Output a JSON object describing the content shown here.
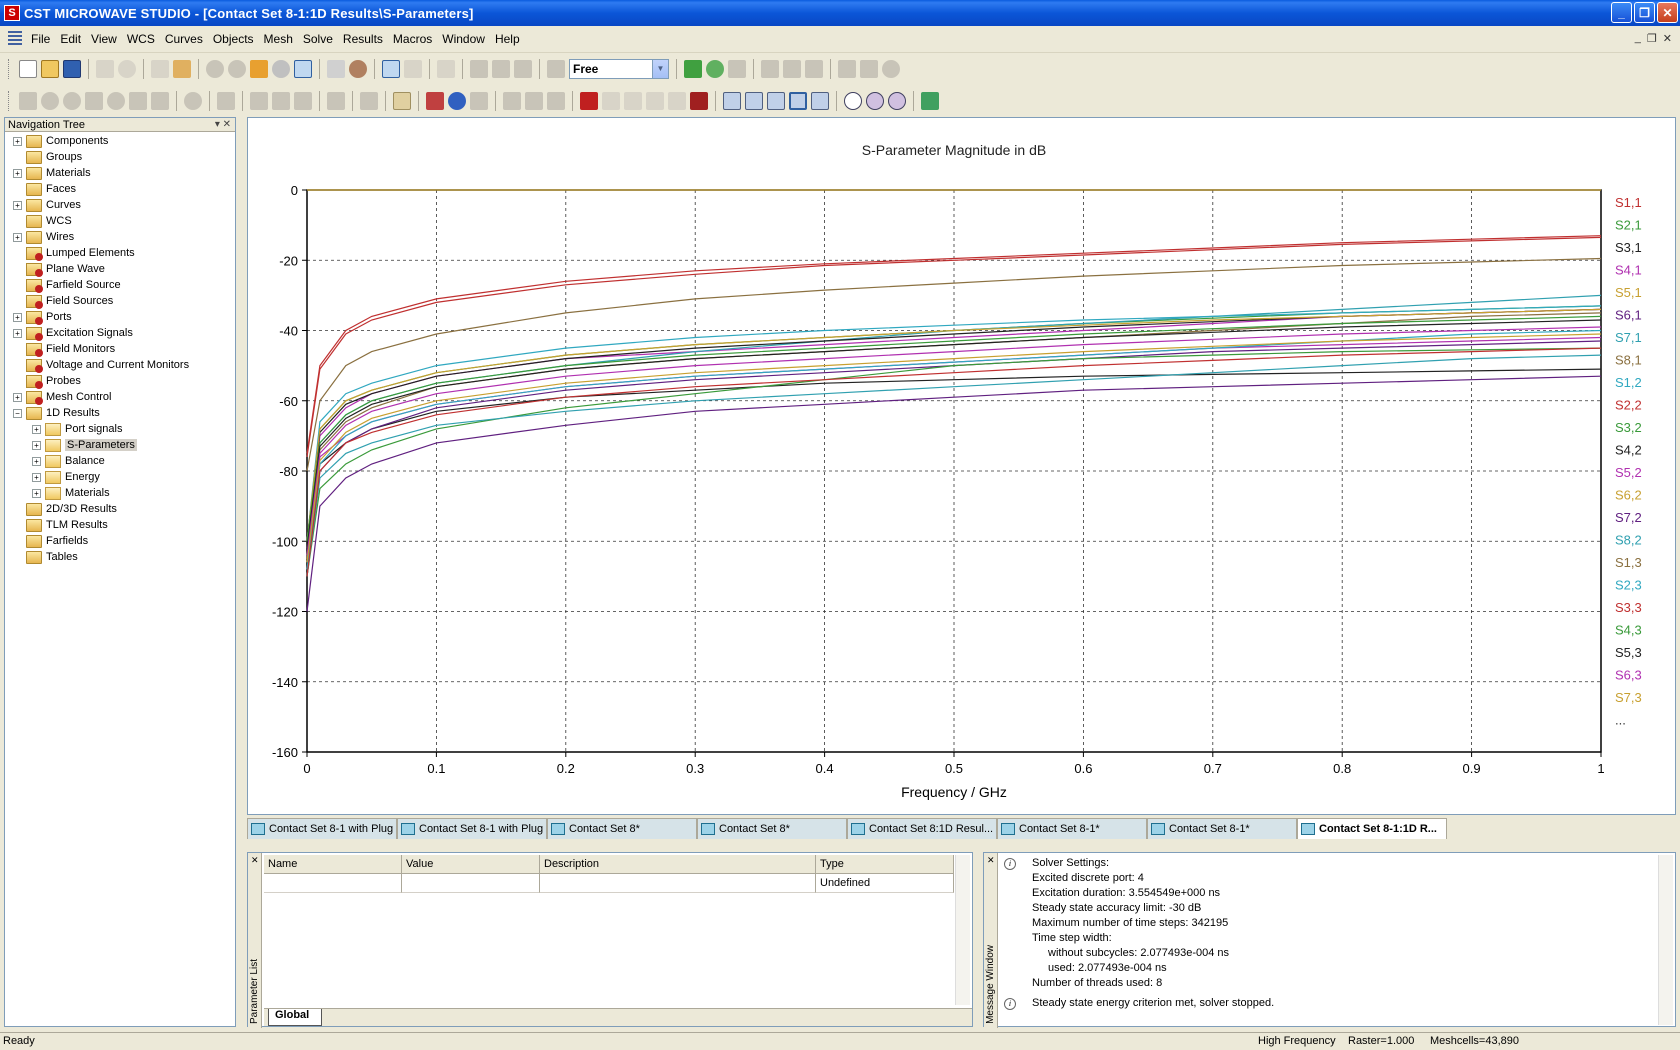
{
  "window": {
    "title": "CST MICROWAVE STUDIO - [Contact Set 8-1:1D Results\\S-Parameters]",
    "app_icon": "S",
    "buttons": {
      "minimize": "_",
      "restore": "❐",
      "close": "✕"
    }
  },
  "menu": {
    "items": [
      "File",
      "Edit",
      "View",
      "WCS",
      "Curves",
      "Objects",
      "Mesh",
      "Solve",
      "Results",
      "Macros",
      "Window",
      "Help"
    ],
    "mdi": {
      "minimize": "_",
      "restore": "❐",
      "close": "✕"
    }
  },
  "toolbar": {
    "mode_combo": "Free"
  },
  "nav": {
    "header": "Navigation Tree",
    "items": [
      {
        "label": "Components",
        "icon": "folder-icon",
        "expand": "+",
        "indent": 0,
        "style": "gold"
      },
      {
        "label": "Groups",
        "icon": "folder-icon",
        "expand": "",
        "indent": 0,
        "style": "gold"
      },
      {
        "label": "Materials",
        "icon": "folder-icon",
        "expand": "+",
        "indent": 0,
        "style": "gold"
      },
      {
        "label": "Faces",
        "icon": "folder-icon",
        "expand": "",
        "indent": 0,
        "style": "gold"
      },
      {
        "label": "Curves",
        "icon": "folder-icon",
        "expand": "+",
        "indent": 0,
        "style": "gold"
      },
      {
        "label": "WCS",
        "icon": "folder-icon",
        "expand": "",
        "indent": 0,
        "style": "gold"
      },
      {
        "label": "Wires",
        "icon": "folder-icon",
        "expand": "+",
        "indent": 0,
        "style": "gold"
      },
      {
        "label": "Lumped Elements",
        "icon": "folder-red-icon",
        "expand": "",
        "indent": 0,
        "style": "red"
      },
      {
        "label": "Plane Wave",
        "icon": "folder-red-icon",
        "expand": "",
        "indent": 0,
        "style": "red"
      },
      {
        "label": "Farfield Source",
        "icon": "folder-red-icon",
        "expand": "",
        "indent": 0,
        "style": "red"
      },
      {
        "label": "Field Sources",
        "icon": "folder-red-icon",
        "expand": "",
        "indent": 0,
        "style": "red"
      },
      {
        "label": "Ports",
        "icon": "folder-red-icon",
        "expand": "+",
        "indent": 0,
        "style": "red"
      },
      {
        "label": "Excitation Signals",
        "icon": "folder-red-icon",
        "expand": "+",
        "indent": 0,
        "style": "red"
      },
      {
        "label": "Field Monitors",
        "icon": "folder-red-icon",
        "expand": "",
        "indent": 0,
        "style": "red"
      },
      {
        "label": "Voltage and Current Monitors",
        "icon": "folder-red-icon",
        "expand": "",
        "indent": 0,
        "style": "red"
      },
      {
        "label": "Probes",
        "icon": "folder-red-icon",
        "expand": "",
        "indent": 0,
        "style": "red"
      },
      {
        "label": "Mesh Control",
        "icon": "folder-red-icon",
        "expand": "+",
        "indent": 0,
        "style": "red"
      },
      {
        "label": "1D Results",
        "icon": "folder-open-icon",
        "expand": "−",
        "indent": 0,
        "style": "gold"
      },
      {
        "label": "Port signals",
        "icon": "folder-icon",
        "expand": "+",
        "indent": 1,
        "style": "plain"
      },
      {
        "label": "S-Parameters",
        "icon": "folder-icon",
        "expand": "+",
        "indent": 1,
        "style": "plain",
        "selected": true
      },
      {
        "label": "Balance",
        "icon": "folder-icon",
        "expand": "+",
        "indent": 1,
        "style": "plain"
      },
      {
        "label": "Energy",
        "icon": "folder-icon",
        "expand": "+",
        "indent": 1,
        "style": "plain"
      },
      {
        "label": "Materials",
        "icon": "folder-icon",
        "expand": "+",
        "indent": 1,
        "style": "plain"
      },
      {
        "label": "2D/3D Results",
        "icon": "folder-icon",
        "expand": "",
        "indent": 0,
        "style": "gold"
      },
      {
        "label": "TLM Results",
        "icon": "folder-icon",
        "expand": "",
        "indent": 0,
        "style": "gold"
      },
      {
        "label": "Farfields",
        "icon": "folder-icon",
        "expand": "",
        "indent": 0,
        "style": "gold"
      },
      {
        "label": "Tables",
        "icon": "folder-icon",
        "expand": "",
        "indent": 0,
        "style": "gold"
      }
    ]
  },
  "chart_data": {
    "type": "line",
    "title": "S-Parameter Magnitude in dB",
    "xlabel": "Frequency / GHz",
    "ylabel": "",
    "xlim": [
      0,
      1
    ],
    "ylim": [
      -160,
      0
    ],
    "xticks": [
      0,
      0.1,
      0.2,
      0.3,
      0.4,
      0.5,
      0.6,
      0.7,
      0.8,
      0.9,
      1
    ],
    "yticks": [
      0,
      -20,
      -40,
      -60,
      -80,
      -100,
      -120,
      -140,
      -160
    ],
    "grid": true,
    "legend_placement": "right",
    "legend_more": "...",
    "x": [
      0,
      0.01,
      0.03,
      0.05,
      0.1,
      0.2,
      0.3,
      0.4,
      0.5,
      0.6,
      0.7,
      0.8,
      0.9,
      1.0
    ],
    "series": [
      {
        "name": "S1,1",
        "color": "#c03030",
        "values": [
          -75,
          -50,
          -40,
          -36,
          -31,
          -26,
          -23,
          -21,
          -19.5,
          -18,
          -16.5,
          -15,
          -14,
          -13
        ]
      },
      {
        "name": "S2,1",
        "color": "#3a9a3a",
        "values": [
          -100,
          -68,
          -60,
          -57,
          -52,
          -47,
          -44,
          -42,
          -40,
          -38,
          -36.5,
          -35,
          -34,
          -33
        ]
      },
      {
        "name": "S3,1",
        "color": "#222222",
        "values": [
          -100,
          -78,
          -72,
          -68,
          -63,
          -59,
          -57,
          -55,
          -54,
          -53,
          -52.5,
          -52,
          -51.5,
          -51
        ]
      },
      {
        "name": "S4,1",
        "color": "#b030b0",
        "values": [
          -100,
          -70,
          -62,
          -58,
          -53,
          -48,
          -46,
          -44,
          -42,
          -40,
          -38,
          -36,
          -35,
          -34
        ]
      },
      {
        "name": "S5,1",
        "color": "#c8a030",
        "values": [
          0,
          0,
          0,
          0,
          0,
          0,
          0,
          0,
          0,
          0,
          0,
          0,
          0,
          0
        ]
      },
      {
        "name": "S6,1",
        "color": "#602080",
        "values": [
          -110,
          -80,
          -72,
          -68,
          -62,
          -57,
          -54,
          -52,
          -50,
          -48,
          -46,
          -45,
          -44,
          -43
        ]
      },
      {
        "name": "S7,1",
        "color": "#30a0b0",
        "values": [
          -105,
          -72,
          -64,
          -60,
          -55,
          -50,
          -46,
          -43,
          -40,
          -38,
          -36,
          -34,
          -32,
          -30
        ]
      },
      {
        "name": "S8,1",
        "color": "#8a7040",
        "values": [
          -80,
          -60,
          -50,
          -46,
          -41,
          -35,
          -31,
          -28.5,
          -26.5,
          -24.5,
          -23,
          -21.5,
          -20.5,
          -19.5
        ]
      },
      {
        "name": "S1,2",
        "color": "#30a8c0",
        "values": [
          -100,
          -66,
          -58,
          -55,
          -50,
          -45,
          -42,
          -40,
          -38.5,
          -37,
          -36,
          -35,
          -34,
          -33
        ]
      },
      {
        "name": "S2,2",
        "color": "#c03030",
        "values": [
          -76,
          -51,
          -41,
          -37,
          -32,
          -27,
          -24,
          -21.5,
          -20,
          -18.5,
          -17,
          -15.5,
          -14.5,
          -13.5
        ]
      },
      {
        "name": "S3,2",
        "color": "#3a9a3a",
        "values": [
          -110,
          -85,
          -78,
          -74,
          -68,
          -62,
          -58,
          -54,
          -50,
          -48,
          -47,
          -46,
          -45.5,
          -45
        ]
      },
      {
        "name": "S4,2",
        "color": "#222222",
        "values": [
          -100,
          -69,
          -61,
          -58,
          -53,
          -48,
          -45,
          -43,
          -41,
          -39,
          -37.5,
          -36,
          -35,
          -34
        ]
      },
      {
        "name": "S5,2",
        "color": "#b030b0",
        "values": [
          -105,
          -76,
          -70,
          -66,
          -61,
          -56,
          -53,
          -51,
          -49,
          -47,
          -45,
          -44,
          -43,
          -42
        ]
      },
      {
        "name": "S6,2",
        "color": "#c8a030",
        "values": [
          -100,
          -68,
          -60,
          -57,
          -52,
          -47,
          -44,
          -42,
          -40,
          -38.5,
          -37,
          -36,
          -35,
          -34
        ]
      },
      {
        "name": "S7,2",
        "color": "#602080",
        "values": [
          -120,
          -90,
          -82,
          -78,
          -72,
          -67,
          -63,
          -61,
          -59,
          -57,
          -56,
          -55,
          -54,
          -53
        ]
      },
      {
        "name": "S8,2",
        "color": "#30a0b0",
        "values": [
          -110,
          -82,
          -75,
          -72,
          -67,
          -63,
          -60,
          -58,
          -56,
          -54,
          -52,
          -50,
          -48,
          -47
        ]
      },
      {
        "name": "S1,3",
        "color": "#8a7040",
        "values": [
          -105,
          -74,
          -66,
          -62,
          -56,
          -51,
          -48,
          -46,
          -44,
          -42,
          -40,
          -38,
          -36,
          -35
        ]
      },
      {
        "name": "S2,3",
        "color": "#30a8c0",
        "values": [
          -108,
          -78,
          -70,
          -66,
          -61,
          -56,
          -53,
          -51,
          -49,
          -47,
          -45,
          -43,
          -41,
          -40
        ]
      },
      {
        "name": "S3,3",
        "color": "#c03030",
        "values": [
          -110,
          -80,
          -72,
          -69,
          -64,
          -59,
          -56,
          -54,
          -52,
          -50,
          -48.5,
          -47,
          -46,
          -45
        ]
      },
      {
        "name": "S4,3",
        "color": "#3a9a3a",
        "values": [
          -100,
          -72,
          -64,
          -60,
          -55,
          -50,
          -47,
          -45,
          -43,
          -41,
          -39.5,
          -38,
          -37,
          -36
        ]
      },
      {
        "name": "S5,3",
        "color": "#222222",
        "values": [
          -102,
          -73,
          -65,
          -61,
          -56,
          -51,
          -48,
          -46,
          -44,
          -42,
          -40.5,
          -39,
          -38,
          -37
        ]
      },
      {
        "name": "S6,3",
        "color": "#b030b0",
        "values": [
          -104,
          -75,
          -67,
          -63,
          -58,
          -53,
          -50,
          -48,
          -46,
          -44,
          -42.5,
          -41,
          -40,
          -39
        ]
      },
      {
        "name": "S7,3",
        "color": "#c8a030",
        "values": [
          -106,
          -77,
          -69,
          -65,
          -60,
          -55,
          -52,
          -50,
          -48,
          -46,
          -44.5,
          -43,
          -42,
          -41
        ]
      }
    ]
  },
  "doctabs": [
    {
      "label": "Contact Set 8-1 with Plug",
      "icon": "wave-icon",
      "active": false
    },
    {
      "label": "Contact Set 8-1 with Plug",
      "icon": "schematic-icon",
      "active": false
    },
    {
      "label": "Contact Set 8*",
      "icon": "wave-icon",
      "active": false
    },
    {
      "label": "Contact Set 8*",
      "icon": "schematic-icon",
      "active": false
    },
    {
      "label": "Contact Set 8:1D Resul...",
      "icon": "grid-icon",
      "active": false
    },
    {
      "label": "Contact Set 8-1*",
      "icon": "wave-icon",
      "active": false
    },
    {
      "label": "Contact Set 8-1*",
      "icon": "schematic-icon",
      "active": false
    },
    {
      "label": "Contact Set 8-1:1D R...",
      "icon": "grid-icon",
      "active": true
    }
  ],
  "param": {
    "side_label": "Parameter List",
    "columns": [
      "Name",
      "Value",
      "Description",
      "Type"
    ],
    "rows": [
      [
        "",
        "",
        "",
        "Undefined"
      ]
    ],
    "tab": "Global"
  },
  "messages": {
    "side_label": "Message Window",
    "lines": [
      {
        "text": "Solver Settings:",
        "icon": "i",
        "indent": 0
      },
      {
        "text": "Excited discrete port: 4",
        "icon": "",
        "indent": 0
      },
      {
        "text": "Excitation duration: 3.554549e+000 ns",
        "icon": "",
        "indent": 0
      },
      {
        "text": "Steady state accuracy limit: -30 dB",
        "icon": "",
        "indent": 0
      },
      {
        "text": "Maximum number of time steps: 342195",
        "icon": "",
        "indent": 0
      },
      {
        "text": "Time step width:",
        "icon": "",
        "indent": 0
      },
      {
        "text": "without subcycles: 2.077493e-004 ns",
        "icon": "",
        "indent": 1
      },
      {
        "text": "used: 2.077493e-004 ns",
        "icon": "",
        "indent": 1
      },
      {
        "text": "Number of threads used: 8",
        "icon": "",
        "indent": 0
      },
      {
        "text": "Steady state energy criterion met, solver stopped.",
        "icon": "i",
        "indent": 0
      }
    ]
  },
  "status": {
    "ready": "Ready",
    "mode": "High Frequency",
    "raster": "Raster=1.000",
    "meshcells": "Meshcells=43,890"
  }
}
